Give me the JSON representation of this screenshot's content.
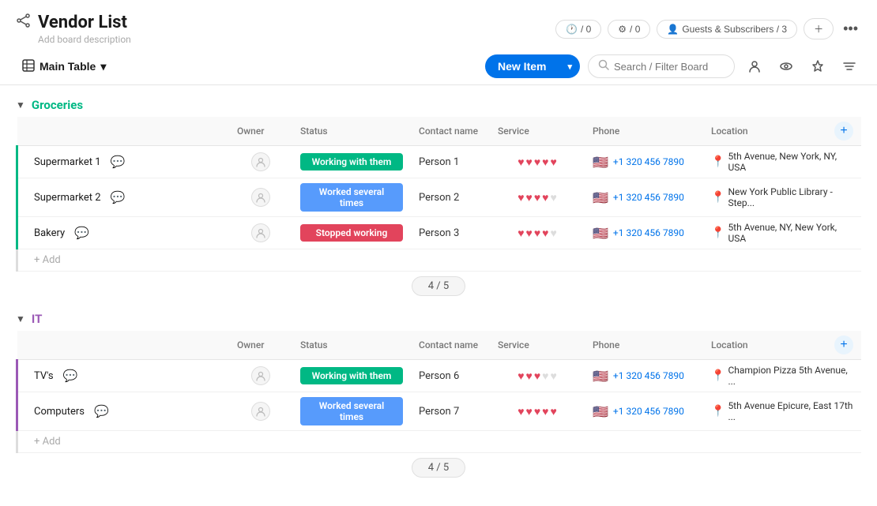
{
  "header": {
    "title": "Vendor List",
    "description": "Add board description",
    "share_icon": "⇗",
    "activity_btn": "/ 0",
    "automations_btn": "/ 0",
    "guests_btn": "Guests & Subscribers / 3",
    "more_icon": "•••"
  },
  "toolbar": {
    "main_table_label": "Main Table",
    "new_item_label": "New Item",
    "search_placeholder": "Search / Filter Board"
  },
  "groups": [
    {
      "id": "groceries",
      "name": "Groceries",
      "color": "green",
      "items": [
        {
          "name": "Supermarket 1",
          "status": "Working with them",
          "status_class": "status-working",
          "contact": "Person 1",
          "hearts": [
            1,
            1,
            1,
            1,
            1
          ],
          "phone": "+1 320 456 7890",
          "location": "5th Avenue, New York, NY, USA"
        },
        {
          "name": "Supermarket 2",
          "status": "Worked several times",
          "status_class": "status-worked",
          "contact": "Person 2",
          "hearts": [
            1,
            1,
            1,
            1,
            0
          ],
          "phone": "+1 320 456 7890",
          "location": "New York Public Library - Step..."
        },
        {
          "name": "Bakery",
          "status": "Stopped working",
          "status_class": "status-stopped",
          "contact": "Person 3",
          "hearts": [
            1,
            1,
            1,
            1,
            0
          ],
          "phone": "+1 320 456 7890",
          "location": "5th Avenue, NY, New York, USA"
        }
      ],
      "add_label": "+ Add",
      "summary": "4 / 5"
    },
    {
      "id": "it",
      "name": "IT",
      "color": "purple",
      "items": [
        {
          "name": "TV's",
          "status": "Working with them",
          "status_class": "status-working",
          "contact": "Person 6",
          "hearts": [
            1,
            1,
            1,
            0,
            0
          ],
          "phone": "+1 320 456 7890",
          "location": "Champion Pizza 5th Avenue, ..."
        },
        {
          "name": "Computers",
          "status": "Worked several times",
          "status_class": "status-worked",
          "contact": "Person 7",
          "hearts": [
            1,
            1,
            1,
            1,
            1
          ],
          "phone": "+1 320 456 7890",
          "location": "5th Avenue Epicure, East 17th ..."
        }
      ],
      "add_label": "+ Add",
      "summary": "4 / 5"
    }
  ],
  "columns": {
    "owner": "Owner",
    "status": "Status",
    "contact": "Contact name",
    "service": "Service",
    "phone": "Phone",
    "location": "Location"
  }
}
